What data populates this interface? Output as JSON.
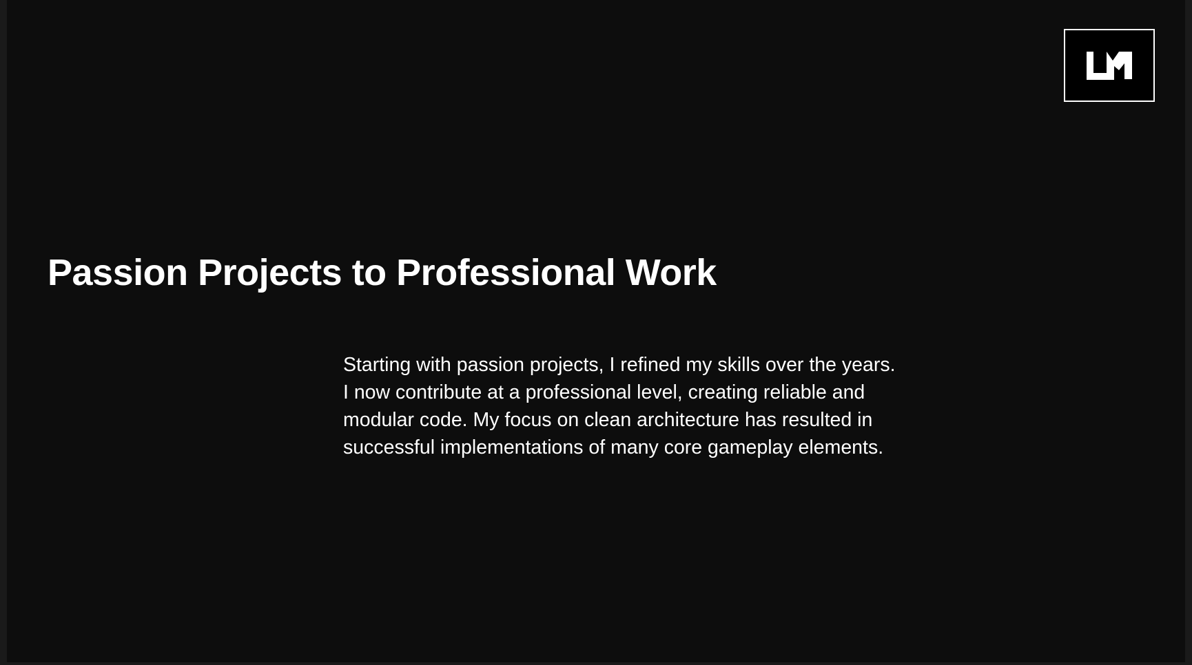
{
  "slide": {
    "title": "Passion Projects to Professional Work",
    "body_lines": [
      "Starting with passion projects, I refined my skills over the years.",
      "I now contribute at a professional level, creating reliable and",
      "modular code. My focus on clean architecture has resulted in",
      "successful implementations of many core gameplay elements."
    ],
    "logo": {
      "text": "LM",
      "icon": "lm-monogram-logo"
    }
  },
  "colors": {
    "background": "#0d0d0d",
    "frame": "#1a1a1a",
    "text": "#ffffff",
    "logo_border": "#ffffff"
  }
}
